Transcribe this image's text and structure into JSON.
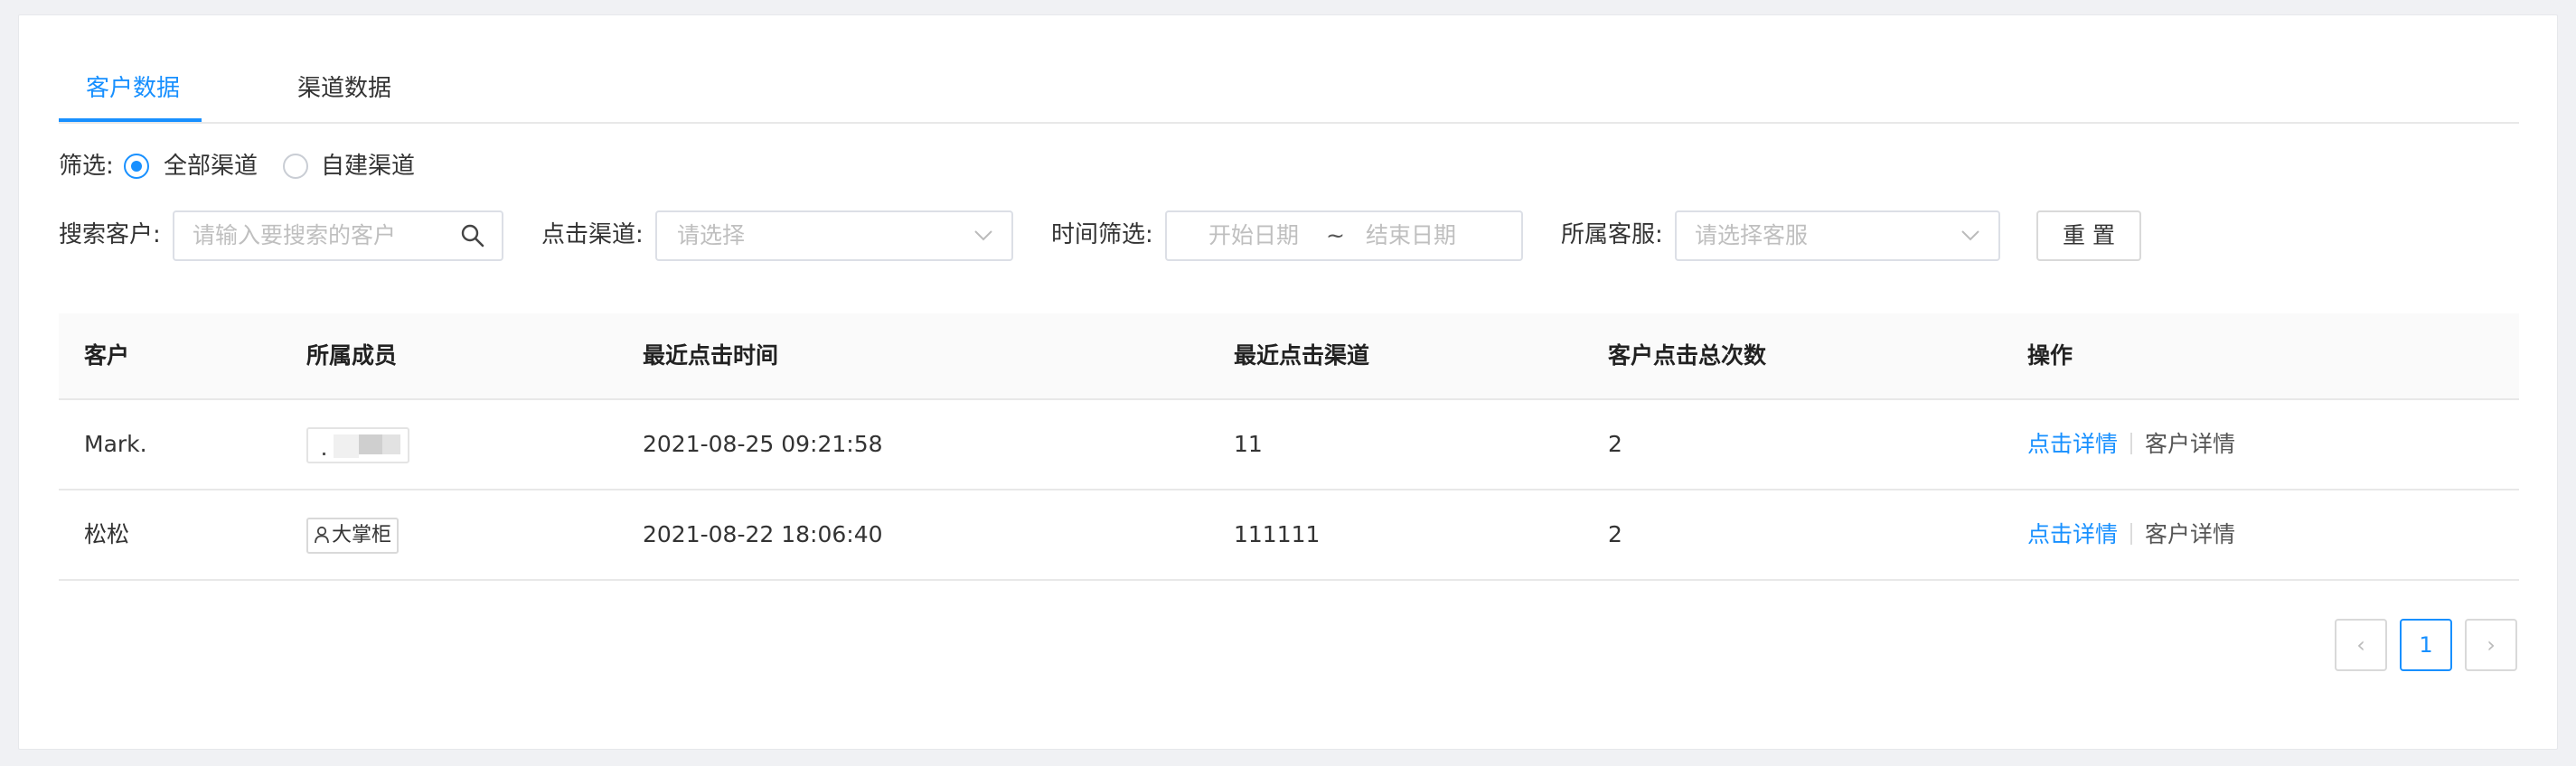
{
  "tabs": [
    {
      "label": "客户数据",
      "active": true
    },
    {
      "label": "渠道数据",
      "active": false
    }
  ],
  "filter": {
    "label": "筛选:",
    "options": [
      {
        "label": "全部渠道",
        "checked": true
      },
      {
        "label": "自建渠道",
        "checked": false
      }
    ]
  },
  "search": {
    "label": "搜索客户:",
    "placeholder": "请输入要搜索的客户"
  },
  "channel": {
    "label": "点击渠道:",
    "placeholder": "请选择"
  },
  "time": {
    "label": "时间筛选:",
    "start_placeholder": "开始日期",
    "separator": "~",
    "end_placeholder": "结束日期"
  },
  "service": {
    "label": "所属客服:",
    "placeholder": "请选择客服"
  },
  "reset_label": "重置",
  "table": {
    "headers": [
      "客户",
      "所属成员",
      "最近点击时间",
      "最近点击渠道",
      "客户点击总次数",
      "操作"
    ],
    "rows": [
      {
        "customer": "Mark.",
        "member": "",
        "time": "2021-08-25 09:21:58",
        "channel": "11",
        "count": "2"
      },
      {
        "customer": "松松",
        "member": "大掌柜",
        "time": "2021-08-22 18:06:40",
        "channel": "111111",
        "count": "2"
      }
    ],
    "actions": {
      "click_detail": "点击详情",
      "customer_detail": "客户详情"
    }
  },
  "pagination": {
    "prev": "‹",
    "current": "1",
    "next": "›"
  },
  "colors": {
    "accent": "#1890ff",
    "background": "#f0f1f4"
  }
}
